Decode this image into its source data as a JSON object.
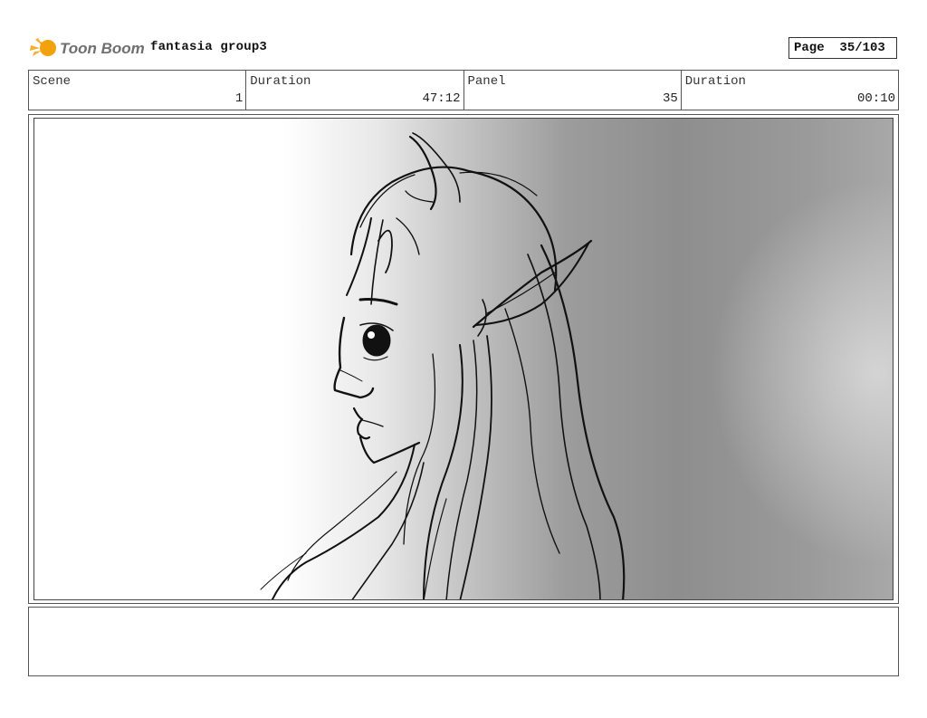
{
  "header": {
    "logo_text": "Toon Boom",
    "project_title": "fantasia group3",
    "page_label": "Page",
    "page_value": "35/103"
  },
  "info": {
    "scene_label": "Scene",
    "scene_value": "1",
    "duration_label": "Duration",
    "duration_value": "47:12",
    "panel_label": "Panel",
    "panel_value": "35",
    "panel_duration_label": "Duration",
    "panel_duration_value": "00:10"
  },
  "panel": {
    "image_subject": "pencil sketch of an elf girl in profile with long hair and pointed ear"
  },
  "notes": {
    "text": ""
  },
  "colors": {
    "logo_orange": "#f2a20c",
    "logo_gray": "#6f6f6f",
    "border": "#555555"
  }
}
